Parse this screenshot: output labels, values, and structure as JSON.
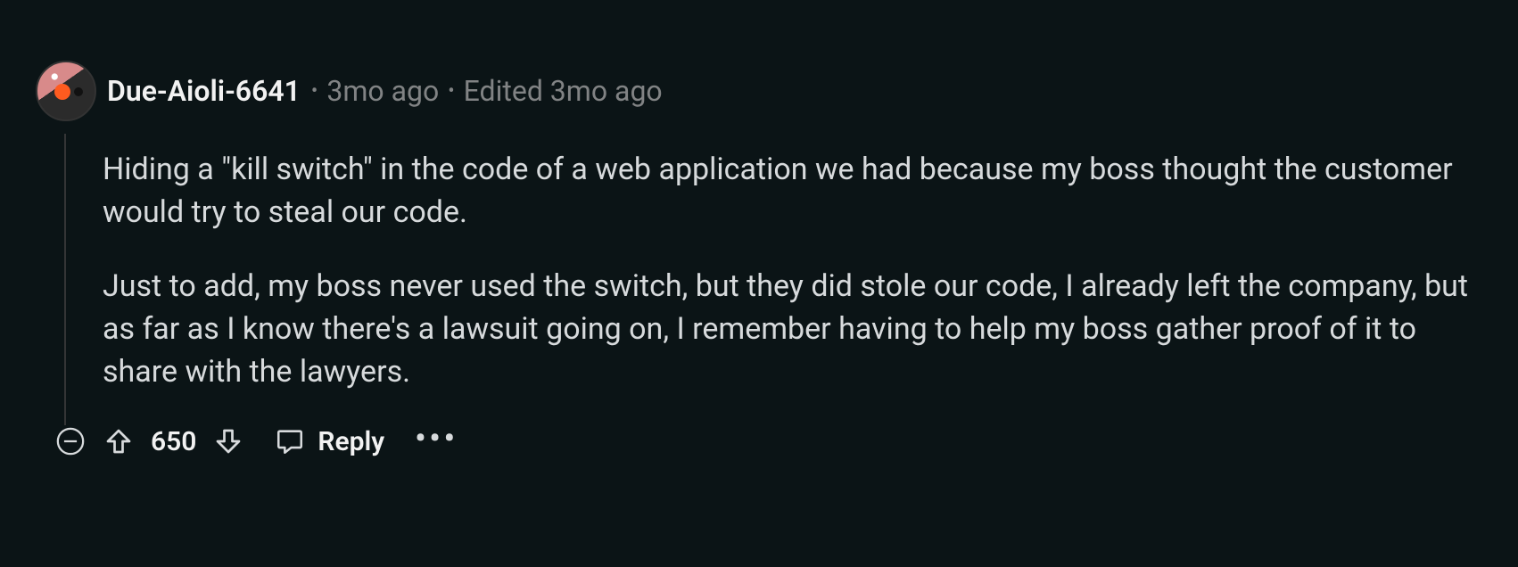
{
  "comment": {
    "username": "Due-Aioli-6641",
    "age": "3mo ago",
    "edited": "Edited 3mo ago",
    "paragraphs": [
      "Hiding a \"kill switch\" in the code of a web application we had because my boss thought the customer would try to steal our code.",
      "Just to add, my boss never used the switch, but they did stole our code, I already left the company, but as far as I know there's a lawsuit going on, I remember having to help my boss gather proof of it to share with the lawyers."
    ],
    "score": "650",
    "reply_label": "Reply"
  }
}
